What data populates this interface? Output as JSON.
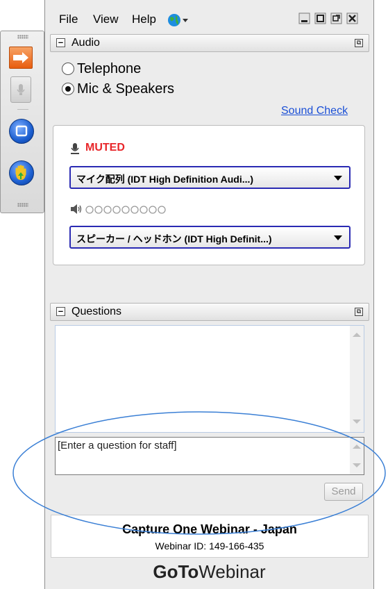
{
  "menu": {
    "file": "File",
    "view": "View",
    "help": "Help"
  },
  "window_controls": [
    "minimize",
    "maximize",
    "popout",
    "close"
  ],
  "audio": {
    "title": "Audio",
    "options": [
      {
        "label": "Telephone",
        "selected": false
      },
      {
        "label": "Mic & Speakers",
        "selected": true
      }
    ],
    "sound_check": "Sound Check",
    "mic_status": "MUTED",
    "mic_device": "マイク配列 (IDT High Definition Audi...)",
    "speaker_device": "スピーカー / ヘッドホン (IDT High Definit...)"
  },
  "questions": {
    "title": "Questions",
    "input_placeholder": "[Enter a question for staff]",
    "send": "Send"
  },
  "footer": {
    "webinar_title": "Capture One Webinar - Japan",
    "webinar_id": "Webinar ID: 149-166-435",
    "brand_bold": "GoTo",
    "brand_light": "Webinar"
  },
  "colors": {
    "muted": "#e8262a",
    "link": "#1a4fd6",
    "annotation": "#3a7fd5"
  }
}
